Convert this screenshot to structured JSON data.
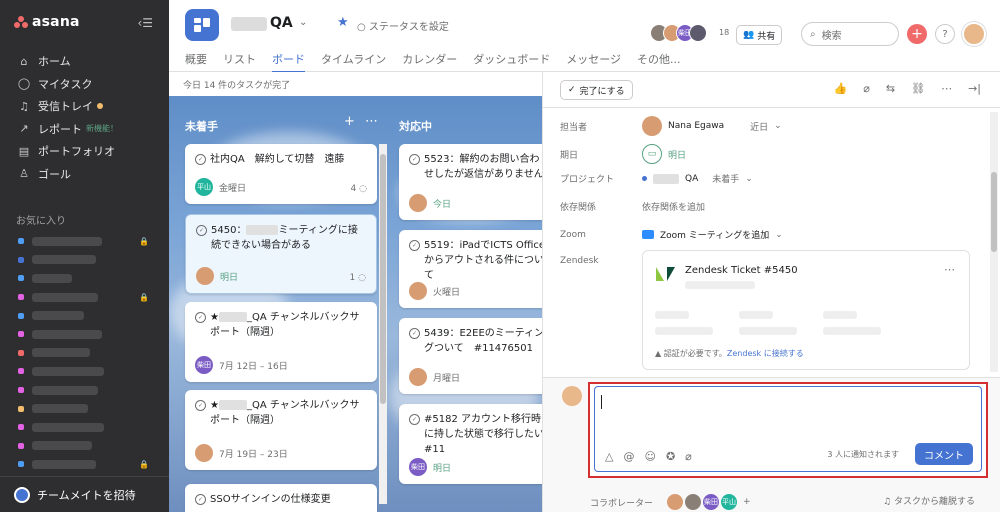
{
  "sidebar": {
    "logo": "asana",
    "nav": [
      {
        "icon": "home-icon",
        "label": "ホーム"
      },
      {
        "icon": "check-circle-icon",
        "label": "マイタスク"
      },
      {
        "icon": "bell-icon",
        "label": "受信トレイ"
      },
      {
        "icon": "trend-icon",
        "label": "レポート",
        "badge": "新機能！"
      },
      {
        "icon": "portfolio-icon",
        "label": "ポートフォリオ"
      },
      {
        "icon": "person-icon",
        "label": "ゴール"
      }
    ],
    "favorites_header": "お気に入り",
    "favorite_colors": [
      "#4f9ef5",
      "#4573d2",
      "#4f9ef5",
      "#e362e3",
      "#4f9ef5",
      "#e362e3",
      "#f06a6a",
      "#e362e3",
      "#e362e3",
      "#f1bd6c",
      "#e362e3",
      "#e362e3",
      "#4f9ef5"
    ],
    "invite_label": "チームメイトを招待"
  },
  "header": {
    "project_title": "QA",
    "status_label": "ステータスを設定",
    "tabs": [
      "概要",
      "リスト",
      "ボード",
      "タイムライン",
      "カレンダー",
      "ダッシュボード",
      "メッセージ",
      "その他..."
    ],
    "active_tab": "ボード",
    "member_count": "18",
    "share_label": "共有",
    "search_placeholder": "検索"
  },
  "board": {
    "completed_text": "今日 14 件のタスクが完了",
    "columns": [
      {
        "name": "未着手"
      },
      {
        "name": "対応中"
      }
    ],
    "cards_col1": [
      {
        "title": "社内QA　解約して切替　遠藤",
        "assignee": "平山",
        "date": "金曜日",
        "comments": "4"
      },
      {
        "title_prefix": "5450：",
        "title_suffix": "ミーティングに接続できない場合がある",
        "date": "明日",
        "comments": "1"
      },
      {
        "title_prefix": "★",
        "title_suffix": "_QA チャンネルバックサポート（隔週）",
        "assignee": "柴田",
        "date": "7月 12日 – 16日"
      },
      {
        "title_prefix": "★",
        "title_suffix": "_QA チャンネルバックサポート（隔週）",
        "date": "7月 19日 – 23日"
      },
      {
        "title": "SSOサインインの仕様変更"
      }
    ],
    "cards_col2": [
      {
        "title": "5523：解約のお問い合わせしたが返信がありません",
        "date": "今日"
      },
      {
        "title": "5519：iPadでICTS Officeからアウトされる件について",
        "date": "火曜日"
      },
      {
        "title": "5439：E2EEのミーティングついて　#11476501",
        "date": "月曜日"
      },
      {
        "title": "#5182 アカウント移行時に持した状態で移行したい #11",
        "assignee": "柴田",
        "date": "明日"
      }
    ]
  },
  "detail": {
    "complete_label": "完了にする",
    "fields": {
      "assignee_label": "担当者",
      "assignee_value": "Nana Egawa",
      "assignee_extra": "近日",
      "due_label": "期日",
      "due_value": "明日",
      "project_label": "プロジェクト",
      "project_value": "QA",
      "project_section": "未着手",
      "deps_label": "依存関係",
      "deps_value": "依存関係を追加",
      "zoom_label": "Zoom",
      "zoom_value": "Zoom ミーティングを追加",
      "zendesk_label": "Zendesk"
    },
    "zendesk": {
      "title": "Zendesk Ticket #5450",
      "auth_text": "認証が必要です。",
      "auth_link": "Zendesk に接続する"
    },
    "comment": {
      "notify_text": "3 人に通知されます",
      "button": "コメント"
    },
    "collaborators_label": "コラボレーター",
    "collab_initials": [
      "柴田",
      "平山"
    ],
    "leave_label": "タスクから離脱する"
  }
}
